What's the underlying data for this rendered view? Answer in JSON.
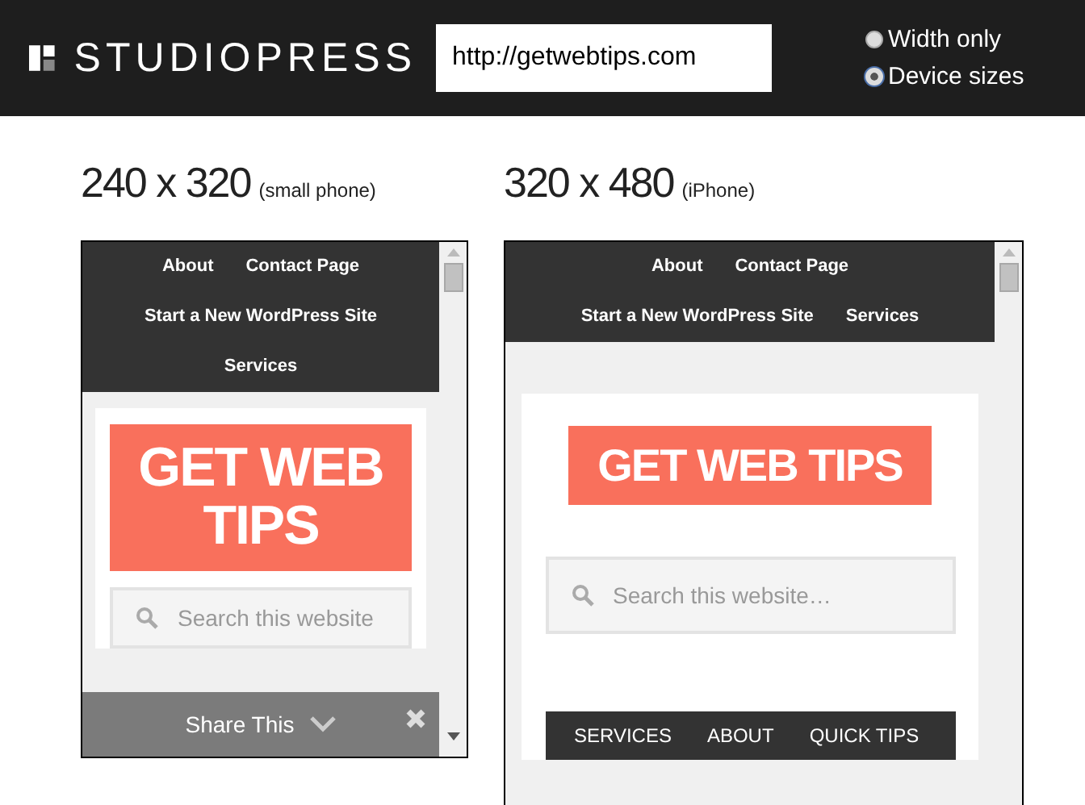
{
  "header": {
    "logo": "STUDIOPRESS",
    "url": "http://getwebtips.com",
    "modes": [
      {
        "label": "Width only",
        "selected": false
      },
      {
        "label": "Device sizes",
        "selected": true
      }
    ]
  },
  "previews": [
    {
      "size": "240 x 320",
      "device": "(small phone)",
      "nav": [
        "About",
        "Contact Page",
        "Start a New WordPress Site",
        "Services"
      ],
      "logo": "GET WEB TIPS",
      "search_placeholder": "Search this website",
      "share_bar": {
        "label": "Share This"
      }
    },
    {
      "size": "320 x 480",
      "device": "(iPhone)",
      "nav": [
        "About",
        "Contact Page",
        "Start a New WordPress Site",
        "Services"
      ],
      "logo": "GET WEB TIPS",
      "search_placeholder": "Search this website…",
      "footer_nav": [
        "SERVICES",
        "ABOUT",
        "QUICK TIPS"
      ]
    }
  ]
}
